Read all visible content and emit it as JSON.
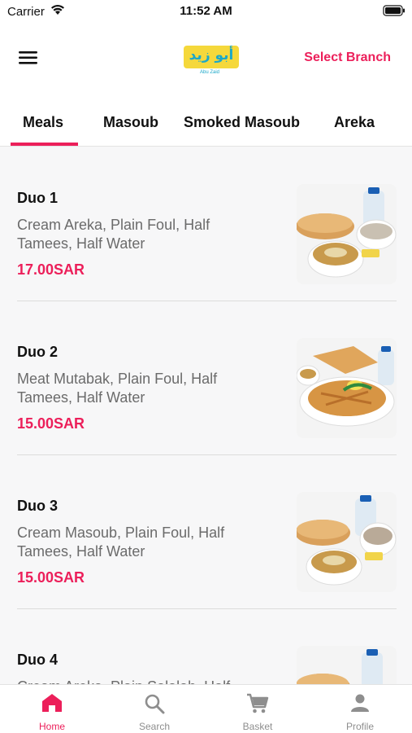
{
  "status_bar": {
    "carrier": "Carrier",
    "time": "11:52 AM"
  },
  "header": {
    "select_branch": "Select Branch",
    "logo_text": "أبو زيد",
    "logo_subtext": "Abu Zaid"
  },
  "tabs": [
    {
      "label": "Meals",
      "active": true
    },
    {
      "label": "Masoub",
      "active": false
    },
    {
      "label": "Smoked Masoub",
      "active": false
    },
    {
      "label": "Areka",
      "active": false
    }
  ],
  "meals": [
    {
      "title": "Duo 1",
      "description": "Cream Areka, Plain Foul, Half Tamees, Half Water",
      "price": "17.00SAR"
    },
    {
      "title": "Duo 2",
      "description": "Meat Mutabak, Plain Foul, Half Tamees, Half Water",
      "price": "15.00SAR"
    },
    {
      "title": "Duo 3",
      "description": "Cream Masoub, Plain Foul, Half Tamees, Half Water",
      "price": "15.00SAR"
    },
    {
      "title": "Duo 4",
      "description": "Cream Areka, Plain Salalah, Half",
      "price": ""
    }
  ],
  "bottom_nav": [
    {
      "label": "Home",
      "icon": "home-icon",
      "active": true
    },
    {
      "label": "Search",
      "icon": "search-icon",
      "active": false
    },
    {
      "label": "Basket",
      "icon": "cart-icon",
      "active": false
    },
    {
      "label": "Profile",
      "icon": "profile-icon",
      "active": false
    }
  ],
  "colors": {
    "accent": "#ec1f5a",
    "muted": "#8e8e8e",
    "text_secondary": "#6b6b6b"
  }
}
